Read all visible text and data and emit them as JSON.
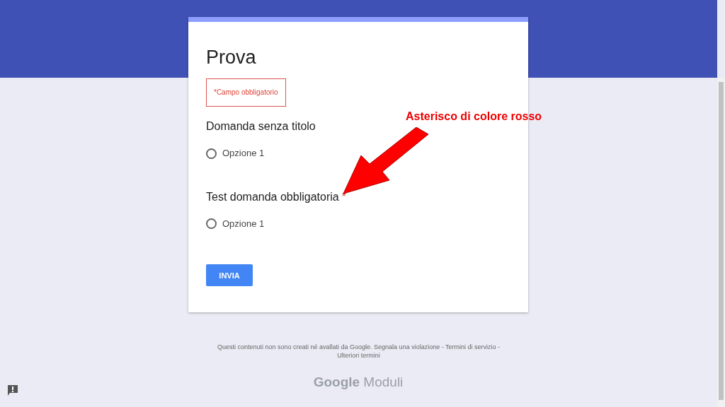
{
  "form": {
    "title": "Prova",
    "required_note": "*Campo obbligatorio",
    "required_mark": "*",
    "questions": [
      {
        "title": "Domanda senza titolo",
        "required": false,
        "options": [
          {
            "label": "Opzione 1",
            "selected": false
          }
        ]
      },
      {
        "title": "Test domanda obbligatoria",
        "required": true,
        "options": [
          {
            "label": "Opzione 1",
            "selected": false
          }
        ]
      }
    ],
    "submit": "INVIA"
  },
  "annotation": {
    "text": "Asterisco di colore rosso"
  },
  "footer": {
    "text": "Questi contenuti non sono creati né avallati da Google.",
    "links": [
      "Segnala una violazione",
      "Termini di servizio",
      "Ulteriori termini"
    ],
    "separator": "-"
  },
  "brand": {
    "name": "Google",
    "product": "Moduli"
  }
}
